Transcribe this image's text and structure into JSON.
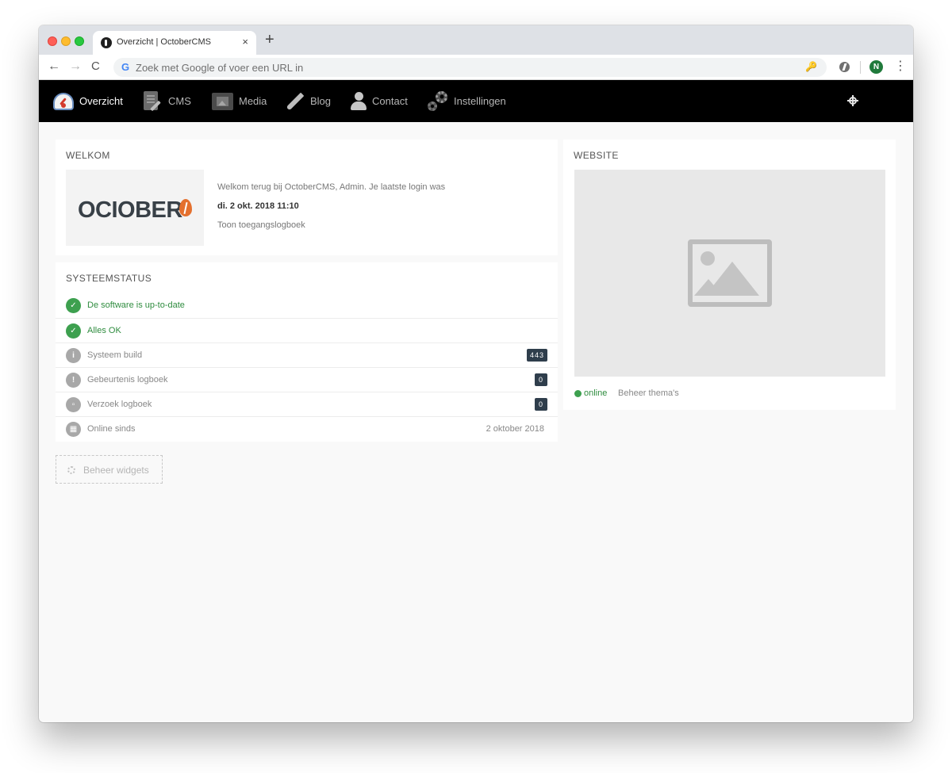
{
  "browser": {
    "tab_title": "Overzicht | OctoberCMS",
    "tab_close": "×",
    "new_tab": "+",
    "back": "←",
    "forward": "→",
    "reload": "C",
    "google_g": "G",
    "url_placeholder": "Zoek met Google of voer een URL in",
    "key_glyph": "🔑",
    "profile_initial": "N",
    "menu_glyph": "⋮"
  },
  "nav": {
    "items": [
      {
        "label": "Overzicht",
        "icon": "dashboard-icon",
        "active": true
      },
      {
        "label": "CMS",
        "icon": "cms-icon",
        "active": false
      },
      {
        "label": "Media",
        "icon": "media-icon",
        "active": false
      },
      {
        "label": "Blog",
        "icon": "blog-icon",
        "active": false
      },
      {
        "label": "Contact",
        "icon": "contact-icon",
        "active": false
      },
      {
        "label": "Instellingen",
        "icon": "settings-icon",
        "active": false
      }
    ],
    "right_icon": "crosshair-icon"
  },
  "welcome": {
    "title": "WELKOM",
    "logo_text": "OCIOBER",
    "message": "Welkom terug bij OctoberCMS, Admin. Je laatste login was",
    "last_login": "di. 2 okt. 2018 11:10",
    "access_log_link": "Toon toegangslogboek"
  },
  "system_status": {
    "title": "SYSTEEMSTATUS",
    "rows": [
      {
        "label": "De software is up-to-date",
        "icon": "check-icon",
        "state": "ok",
        "icon_glyph": "✓"
      },
      {
        "label": "Alles OK",
        "icon": "check-icon",
        "state": "ok",
        "icon_glyph": "✓"
      },
      {
        "label": "Systeem build",
        "icon": "info-icon",
        "state": "info",
        "icon_glyph": "i",
        "badge": "443"
      },
      {
        "label": "Gebeurtenis logboek",
        "icon": "warning-icon",
        "state": "info",
        "icon_glyph": "!",
        "badge": "0"
      },
      {
        "label": "Verzoek logboek",
        "icon": "file-icon",
        "state": "info",
        "icon_glyph": "▫",
        "badge": "0"
      },
      {
        "label": "Online sinds",
        "icon": "calendar-icon",
        "state": "info",
        "icon_glyph": "▦",
        "value": "2 oktober 2018"
      }
    ]
  },
  "manage_widgets": {
    "label": "Beheer widgets"
  },
  "website": {
    "title": "WEBSITE",
    "status": "online",
    "manage_themes": "Beheer thema's"
  },
  "colors": {
    "nav_bg": "#000000",
    "ok_green": "#3da04f",
    "badge_bg": "#2f3e4c",
    "brand_orange": "#e4702e"
  }
}
